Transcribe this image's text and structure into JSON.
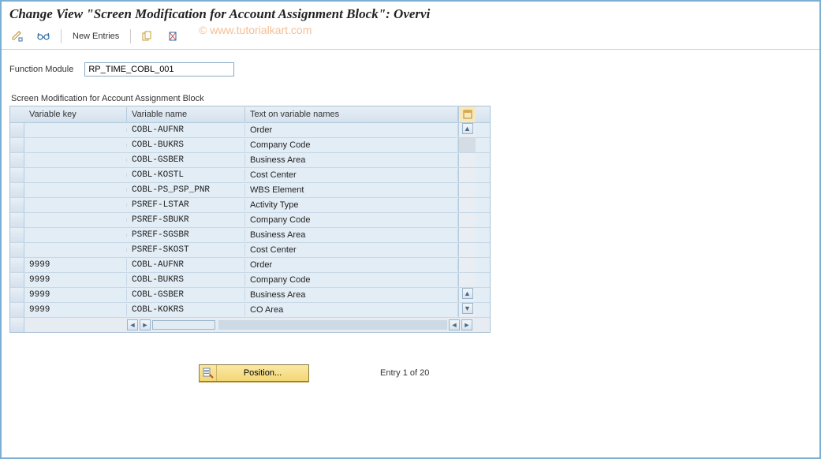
{
  "title": "Change View \"Screen Modification for Account Assignment Block\": Overvi",
  "watermark": "© www.tutorialkart.com",
  "toolbar": {
    "new_entries_label": "New Entries"
  },
  "form": {
    "function_module_label": "Function Module",
    "function_module_value": "RP_TIME_COBL_001"
  },
  "table": {
    "section_title": "Screen Modification for Account Assignment Block",
    "headers": {
      "variable_key": "Variable key",
      "variable_name": "Variable name",
      "text_on_variable": "Text on variable names"
    },
    "rows": [
      {
        "key": "",
        "name": "COBL-AUFNR",
        "text": "Order"
      },
      {
        "key": "",
        "name": "COBL-BUKRS",
        "text": "Company Code"
      },
      {
        "key": "",
        "name": "COBL-GSBER",
        "text": "Business Area"
      },
      {
        "key": "",
        "name": "COBL-KOSTL",
        "text": "Cost Center"
      },
      {
        "key": "",
        "name": "COBL-PS_PSP_PNR",
        "text": "WBS Element"
      },
      {
        "key": "",
        "name": "PSREF-LSTAR",
        "text": "Activity Type"
      },
      {
        "key": "",
        "name": "PSREF-SBUKR",
        "text": "Company Code"
      },
      {
        "key": "",
        "name": "PSREF-SGSBR",
        "text": "Business Area"
      },
      {
        "key": "",
        "name": "PSREF-SKOST",
        "text": "Cost Center"
      },
      {
        "key": "9999",
        "name": "COBL-AUFNR",
        "text": "Order"
      },
      {
        "key": "9999",
        "name": "COBL-BUKRS",
        "text": "Company Code"
      },
      {
        "key": "9999",
        "name": "COBL-GSBER",
        "text": "Business Area"
      },
      {
        "key": "9999",
        "name": "COBL-KOKRS",
        "text": "CO Area"
      }
    ]
  },
  "footer": {
    "position_label": "Position...",
    "entry_status": "Entry 1 of 20"
  }
}
